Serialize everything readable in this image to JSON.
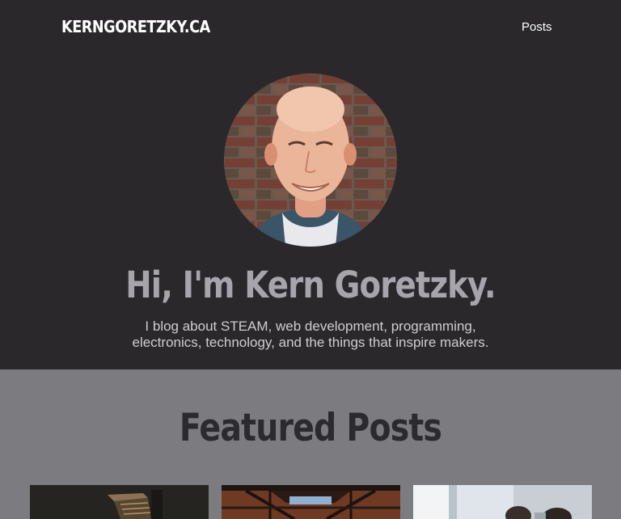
{
  "header": {
    "site_title": "KERNGORETZKY.CA",
    "nav": [
      {
        "label": "Posts"
      }
    ]
  },
  "hero": {
    "heading": "Hi, I'm Kern Goretzky.",
    "tagline_line1": "I blog about STEAM, web development, programming,",
    "tagline_line2": "electronics, technology, and the things that inspire makers."
  },
  "featured": {
    "heading": "Featured Posts"
  },
  "colors": {
    "hero_bg": "#2a282b",
    "featured_bg": "#7c7b80",
    "heading_gray": "#a7a5ab",
    "dark_text": "#2b2a2e"
  }
}
